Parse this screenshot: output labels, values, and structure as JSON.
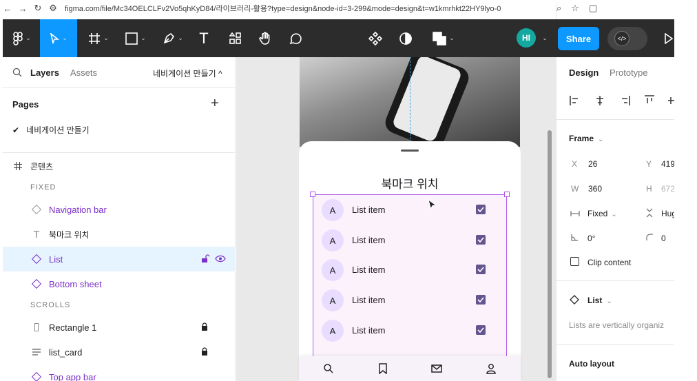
{
  "browser": {
    "url": "figma.com/file/Mc34OELCLFv2Vo5qhKyD84/라이브러리-활용?type=design&node-id=3-299&mode=design&t=w1kmrhkt22HY9lyo-0"
  },
  "toolbar": {
    "avatar_initials": "HI",
    "share_label": "Share",
    "accent": "#0d99ff"
  },
  "left_panel": {
    "tabs": {
      "layers": "Layers",
      "assets": "Assets",
      "page_switch": "네비게이션 만들기 ^"
    },
    "pages_heading": "Pages",
    "page_items": [
      "네비게이션 만들기"
    ],
    "frame_name": "콘텐츠",
    "sections": {
      "fixed": "FIXED",
      "scrolls": "SCROLLS"
    },
    "layers": {
      "navigation_bar": "Navigation bar",
      "bookmark_position": "북마크 위치",
      "list": "List",
      "bottom_sheet": "Bottom sheet",
      "rectangle_1": "Rectangle 1",
      "list_card": "list_card",
      "top_app_bar": "Top app bar"
    }
  },
  "canvas": {
    "sheet_title": "북마크 위치",
    "list_items": [
      {
        "avatar": "A",
        "label": "List item"
      },
      {
        "avatar": "A",
        "label": "List item"
      },
      {
        "avatar": "A",
        "label": "List item"
      },
      {
        "avatar": "A",
        "label": "List item"
      },
      {
        "avatar": "A",
        "label": "List item"
      }
    ]
  },
  "right_panel": {
    "tabs": {
      "design": "Design",
      "prototype": "Prototype"
    },
    "frame_heading": "Frame",
    "props": {
      "x_label": "X",
      "x_value": "26",
      "y_label": "Y",
      "y_value": "419",
      "w_label": "W",
      "w_value": "360",
      "h_label": "H",
      "h_value": "672",
      "width_mode": "Fixed",
      "height_mode": "Hug",
      "rotation": "0°",
      "radius": "0"
    },
    "clip_content": "Clip content",
    "component_name": "List",
    "component_desc": "Lists are vertically organiz",
    "auto_layout": "Auto layout"
  }
}
